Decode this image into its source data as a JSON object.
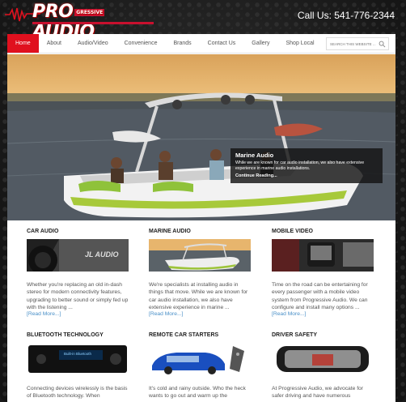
{
  "header": {
    "logo": {
      "pro": "PRO",
      "mid": "GRESSIVE",
      "audio": "AUDIO"
    },
    "phone": "Call Us: 541-776-2344"
  },
  "nav": {
    "items": [
      "Home",
      "About",
      "Audio/Video",
      "Convenience",
      "Brands",
      "Contact Us",
      "Gallery",
      "Shop Local"
    ],
    "active": "Home",
    "search_placeholder": "SEARCH THIS WEBSITE ..."
  },
  "hero": {
    "title": "Marine Audio",
    "text": "While we are known for car audio installation, we also have extensive experience in marine audio installations.",
    "link": "Continue Reading..."
  },
  "services": [
    {
      "title": "CAR AUDIO",
      "image_label": "JL AUDIO",
      "text": "Whether you're replacing an old in-dash stereo for modern connectivity features, upgrading to better sound or simply fed up with the listening ...",
      "more": "[Read More...]"
    },
    {
      "title": "MARINE AUDIO",
      "image_label": "",
      "text": "We're specialists at installing audio in things that move. While we are known for car audio installation, we also have extensive experience in marine ...",
      "more": "[Read More...]"
    },
    {
      "title": "MOBILE VIDEO",
      "image_label": "",
      "text": "Time on the road can be entertaining for every passenger with a mobile video system from Progressive Audio. We can configure and install many options ...",
      "more": "[Read More...]"
    },
    {
      "title": "BLUETOOTH TECHNOLOGY",
      "image_label": "Built-in Bluetooth",
      "text": "Connecting devices wirelessly is the basis of Bluetooth technology. When",
      "more": ""
    },
    {
      "title": "REMOTE CAR STARTERS",
      "image_label": "",
      "text": "It's cold and rainy outside. Who the heck wants to go out and warm up the",
      "more": ""
    },
    {
      "title": "DRIVER SAFETY",
      "image_label": "",
      "text": "At Progressive Audio, we advocate for safer driving and have numerous",
      "more": ""
    }
  ],
  "colors": {
    "accent": "#e0101e",
    "link": "#4a90c8"
  }
}
